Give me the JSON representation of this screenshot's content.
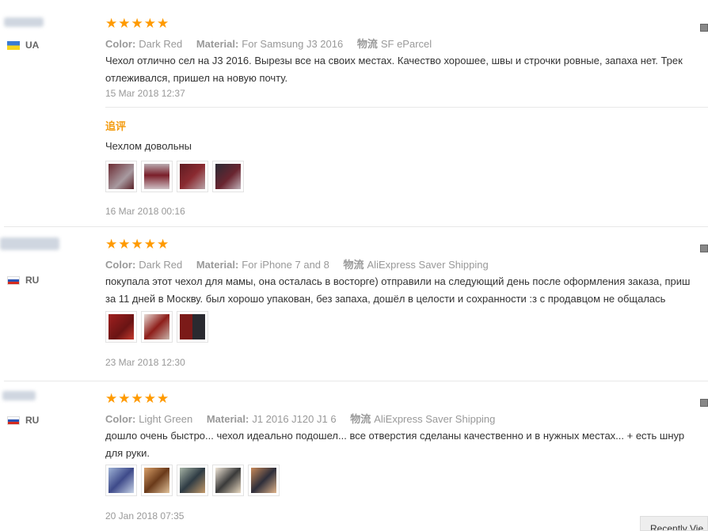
{
  "reviews": [
    {
      "country": "UA",
      "rating_stars": 5,
      "color_label": "Color:",
      "color_value": "Dark Red",
      "material_label": "Material:",
      "material_value": "For Samsung J3 2016",
      "shipping_label": "物流",
      "shipping_value": "SF eParcel",
      "text_line1": "Чехол отлично сел на J3 2016. Вырезы все на своих местах. Качество хорошее, швы и строчки ровные, запаха нет. Трек",
      "text_line2": "отлеживался, пришел на новую почту.",
      "date": "15 Mar 2018 12:37",
      "followup": {
        "label": "追评",
        "text": "Чехлом довольны",
        "date": "16 Mar 2018 00:16",
        "thumb_count": 4
      }
    },
    {
      "country": "RU",
      "rating_stars": 5,
      "color_label": "Color:",
      "color_value": "Dark Red",
      "material_label": "Material:",
      "material_value": "For iPhone 7 and 8",
      "shipping_label": "物流",
      "shipping_value": "AliExpress Saver Shipping",
      "text_line1": "покупала этот чехол для мамы, она осталась в восторге) отправили на следующий день после оформления заказа, приш",
      "text_line2": "за 11 дней в Москву. был хорошо упакован, без запаха, дошёл в целости и сохранности :з с продавцом не общалась",
      "date": "23 Mar 2018 12:30",
      "thumb_count": 3
    },
    {
      "country": "RU",
      "rating_stars": 5,
      "color_label": "Color:",
      "color_value": "Light Green",
      "material_label": "Material:",
      "material_value": "J1 2016 J120 J1 6",
      "shipping_label": "物流",
      "shipping_value": "AliExpress Saver Shipping",
      "text_line1": "дошло очень быстро... чехол идеально подошел... все отверстия сделаны качественно и в нужных местах... + есть шнур",
      "text_line2": "для руки.",
      "date": "20 Jan 2018 07:35",
      "thumb_count": 5
    }
  ],
  "star_glyph": "★",
  "recent_label": "Recently Vie",
  "colors": {
    "star": "#ff9a00",
    "followup": "#f39c12",
    "meta": "#999999"
  }
}
